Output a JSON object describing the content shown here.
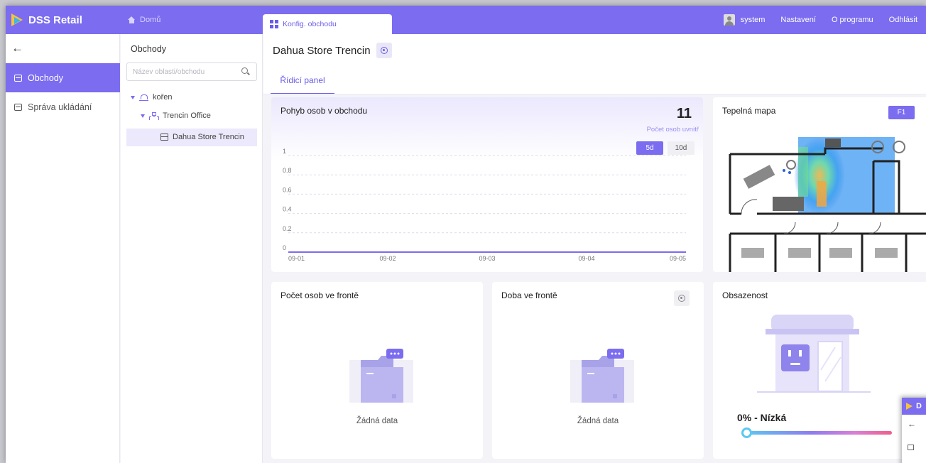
{
  "app": {
    "name": "DSS Retail"
  },
  "topbar": {
    "home_label": "Domů",
    "active_tab_label": "Konfig. obchodu",
    "user_name": "system",
    "settings_label": "Nastavení",
    "about_label": "O programu",
    "logout_label": "Odhlásit"
  },
  "sidebar": {
    "back_icon": "arrow-left-icon",
    "items": [
      {
        "label": "Obchody",
        "icon": "store-icon",
        "active": true
      },
      {
        "label": "Správa ukládání",
        "icon": "storage-icon",
        "active": false
      }
    ]
  },
  "tree": {
    "title": "Obchody",
    "search_placeholder": "Název oblasti/obchodu",
    "nodes": [
      {
        "label": "kořen",
        "icon": "root-icon"
      },
      {
        "label": "Trencin Office",
        "icon": "org-icon"
      },
      {
        "label": "Dahua Store Trencin",
        "icon": "store-icon",
        "selected": true
      }
    ]
  },
  "main": {
    "store_name": "Dahua Store Trencin",
    "subtab_label": "Řídicí panel"
  },
  "people_flow": {
    "title": "Pohyb osob v obchodu",
    "count": "11",
    "count_label": "Počet osob uvnitř",
    "range_buttons": [
      "5d",
      "10d"
    ]
  },
  "chart_data": {
    "type": "line",
    "title": "Pohyb osob v obchodu",
    "x": [
      "09-01",
      "09-02",
      "09-03",
      "09-04",
      "09-05"
    ],
    "y_ticks": [
      "0",
      "0.2",
      "0.4",
      "0.6",
      "0.8",
      "1"
    ],
    "ylim": [
      0,
      1
    ],
    "series": [
      {
        "values": [
          0,
          0,
          0,
          0,
          0
        ]
      }
    ],
    "grid": true,
    "accent_color": "#7b6cf0"
  },
  "heatmap": {
    "title": "Tepelná mapa",
    "floor_label": "F1"
  },
  "queue_count": {
    "title": "Počet osob ve frontě",
    "empty_text": "Žádná data"
  },
  "queue_time": {
    "title": "Doba ve frontě",
    "empty_text": "Žádná data"
  },
  "occupancy": {
    "title": "Obsazenost",
    "value_text": "0% - Nízká",
    "level": 0
  },
  "mini_window": {
    "logo_letter": "D"
  },
  "colors": {
    "accent": "#7b6cf0",
    "accent_dark": "#6a5de8"
  }
}
